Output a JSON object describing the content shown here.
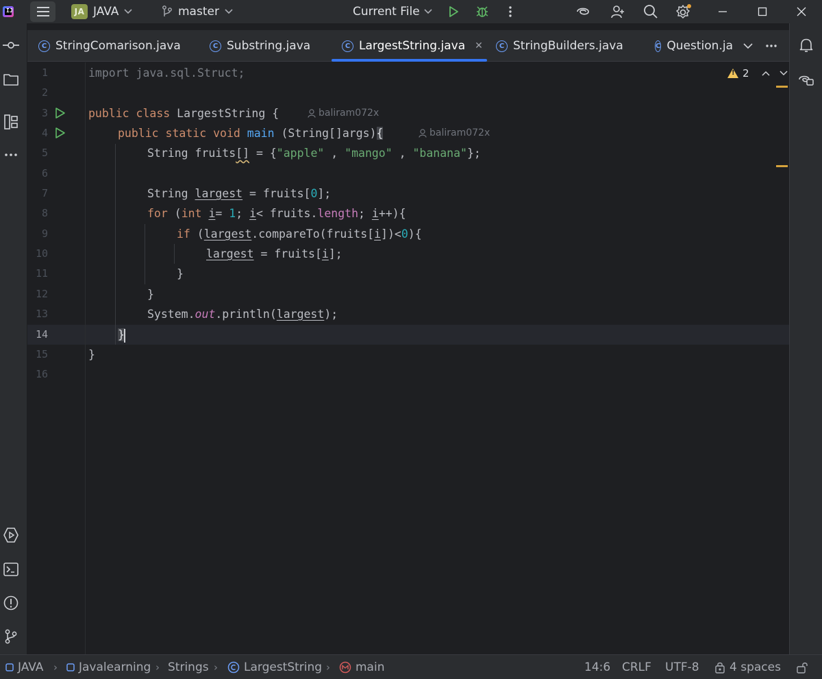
{
  "titlebar": {
    "project_badge": "JA",
    "project_name": "JAVA",
    "branch": "master",
    "run_config": "Current File"
  },
  "tabs": [
    {
      "label": "StringComarison.java"
    },
    {
      "label": "Substring.java"
    },
    {
      "label": "LargestString.java",
      "active": true
    },
    {
      "label": "StringBuilders.java"
    },
    {
      "label": "Question.ja"
    }
  ],
  "inspections": {
    "warning_count": "2"
  },
  "editor": {
    "line_numbers": [
      "1",
      "2",
      "3",
      "4",
      "5",
      "6",
      "7",
      "8",
      "9",
      "10",
      "11",
      "12",
      "13",
      "14",
      "15",
      "16"
    ],
    "current_line": "14",
    "author_hint": "baliram072x",
    "code": {
      "l1": "import java.sql.Struct;",
      "l3_kw1": "public",
      "l3_kw2": "class",
      "l3_name": "LargestString",
      "l3_brace": "{",
      "l4_kw1": "public",
      "l4_kw2": "static",
      "l4_kw3": "void",
      "l4_fn": "main",
      "l4_args": "(String[]args)",
      "l4_brace": "{",
      "l5_type": "String",
      "l5_var": "fruits",
      "l5_arr": "[]",
      "l5_eq": " = {",
      "l5_s1": "\"apple\"",
      "l5_c1": " , ",
      "l5_s2": "\"mango\"",
      "l5_c2": " , ",
      "l5_s3": "\"banana\"",
      "l5_end": "};",
      "l7_type": "String ",
      "l7_var": "largest",
      "l7_rest1": " = fruits[",
      "l7_num": "0",
      "l7_rest2": "];",
      "l8_kw": "for",
      "l8_p1": " (",
      "l8_int": "int",
      "l8_sp": " ",
      "l8_i": "i",
      "l8_eq": "= ",
      "l8_one": "1",
      "l8_semi": "; ",
      "l8_i2": "i",
      "l8_lt": "< fruits.",
      "l8_len": "length",
      "l8_semi2": "; ",
      "l8_i3": "i",
      "l8_end": "++){",
      "l9_kw": "if",
      "l9_p": " (",
      "l9_var": "largest",
      "l9_call": ".compareTo(fruits[",
      "l9_i": "i",
      "l9_lt": "])<",
      "l9_zero": "0",
      "l9_end": "){",
      "l10_var": "largest",
      "l10_mid": " = fruits[",
      "l10_i": "i",
      "l10_end": "];",
      "l11": "}",
      "l12": "}",
      "l13_sys": "System.",
      "l13_out": "out",
      "l13_call": ".println(",
      "l13_var": "largest",
      "l13_end": ");",
      "l14": "}",
      "l15": "}"
    }
  },
  "breadcrumbs": [
    "JAVA",
    "Javalearning",
    "Strings",
    "LargestString",
    "main"
  ],
  "status": {
    "position": "14:6",
    "line_sep": "CRLF",
    "encoding": "UTF-8",
    "indent": "4 spaces"
  },
  "colors": {
    "background": "#1e1f22",
    "panel": "#2b2d30",
    "accent": "#3574f0",
    "keyword": "#cf8e6d",
    "string": "#6aab73",
    "number": "#2aacb8",
    "function": "#56a8f5",
    "field": "#c77dbb"
  }
}
